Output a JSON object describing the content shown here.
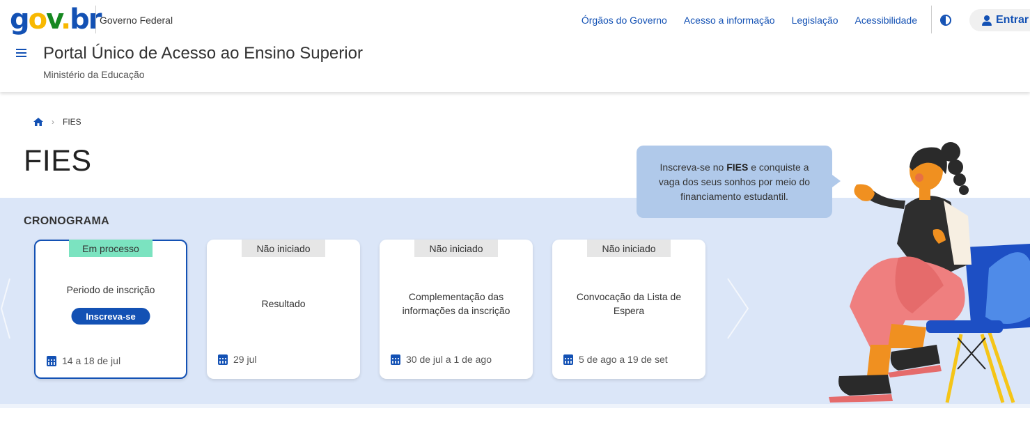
{
  "header": {
    "logo": {
      "g": "g",
      "o": "o",
      "v": "v",
      "dot": ".",
      "br": "br"
    },
    "gov_label": "Governo Federal",
    "links": [
      "Órgãos do Governo",
      "Acesso a informação",
      "Legislação",
      "Acessibilidade"
    ],
    "login_label": "Entrar",
    "portal_title": "Portal Único de Acesso ao Ensino Superior",
    "ministry": "Ministério da Educação"
  },
  "breadcrumb": {
    "current": "FIES"
  },
  "page": {
    "title": "FIES"
  },
  "cronograma": {
    "title": "CRONOGRAMA",
    "cards": [
      {
        "status": "Em processo",
        "label": "Periodo de inscrição",
        "button": "Inscreva-se",
        "date": "14 a 18 de jul",
        "active": true
      },
      {
        "status": "Não iniciado",
        "label": "Resultado",
        "date": "29 jul",
        "active": false
      },
      {
        "status": "Não iniciado",
        "label": "Complementação das informações da inscrição",
        "date": "30 de jul a 1 de ago",
        "active": false
      },
      {
        "status": "Não iniciado",
        "label": "Convocação da Lista de Espera",
        "date": "5 de ago a 19 de set",
        "active": false
      }
    ]
  },
  "bubble": {
    "prefix": "Inscreva-se no ",
    "bold": "FIES",
    "suffix": " e conquiste a vaga dos seus sonhos por meio do financiamento estudantil."
  },
  "colors": {
    "primary": "#1351b4",
    "band": "#dbe6f8",
    "active_status": "#7be3c0",
    "bubble": "#b0c9ea"
  },
  "icons": [
    "menu-icon",
    "home-icon",
    "calendar-icon",
    "user-icon",
    "contrast-icon",
    "chevron-left-icon",
    "chevron-right-icon"
  ]
}
